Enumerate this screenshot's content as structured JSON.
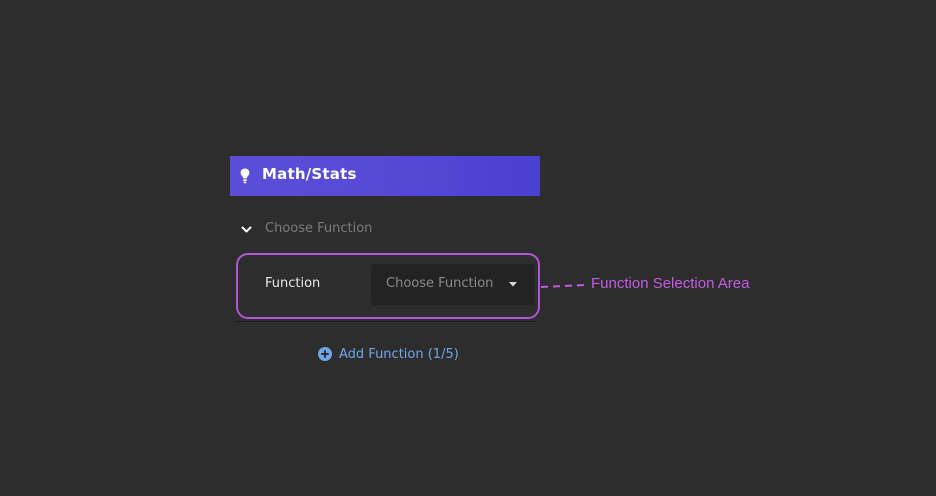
{
  "panel": {
    "header": {
      "title": "Math/Stats",
      "icon": "lightbulb-icon",
      "gradient_start": "#5b4fd8",
      "gradient_end": "#4a3fd0"
    },
    "section": {
      "label": "Choose Function",
      "expanded": true,
      "icon": "chevron-down-icon"
    },
    "function_row": {
      "label": "Function",
      "dropdown": {
        "placeholder": "Choose Function",
        "icon": "caret-down-icon"
      }
    },
    "add_function": {
      "label": "Add Function (1/5)",
      "icon": "plus-circle-icon",
      "color": "#6fa7ec"
    }
  },
  "annotation": {
    "label": "Function Selection Area",
    "color": "#c35ce3"
  }
}
